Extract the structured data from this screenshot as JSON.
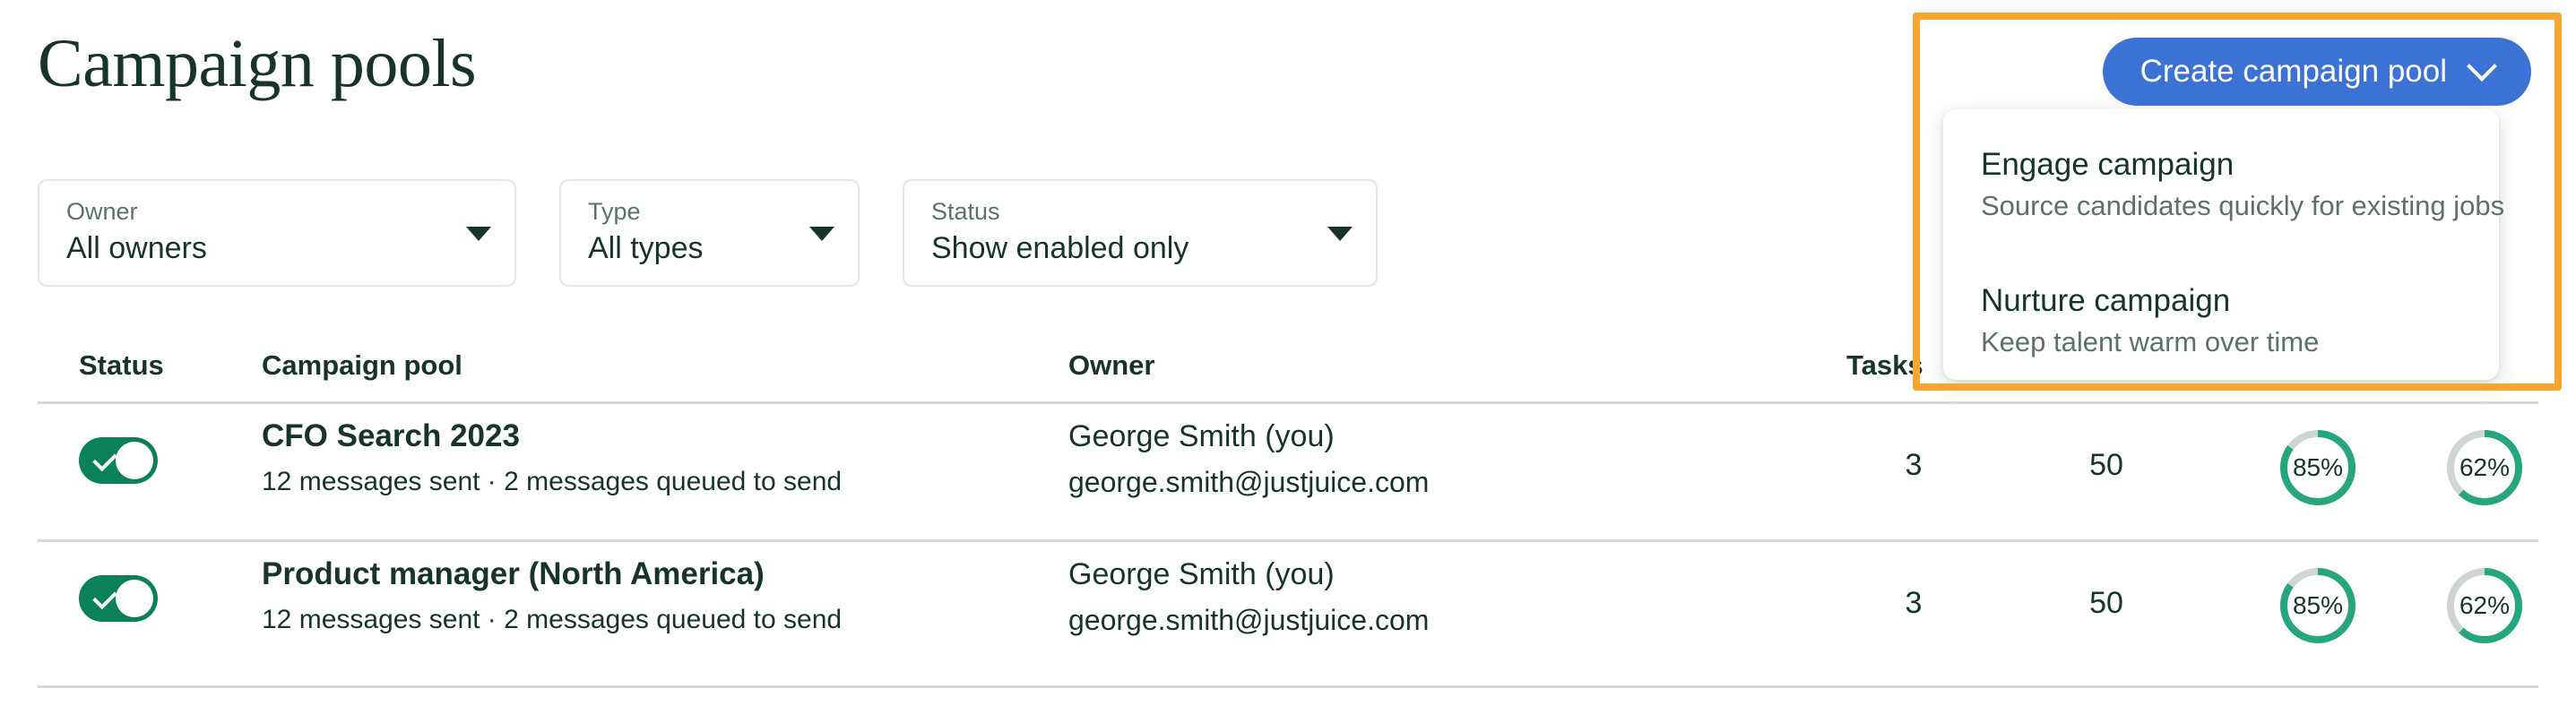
{
  "page": {
    "title": "Campaign pools"
  },
  "colors": {
    "accent_blue": "#3b72d4",
    "brand_green": "#0a8158",
    "ring_green": "#27a57e",
    "ring_track": "#ced5d3",
    "text_dark": "#16342c",
    "text_muted": "#5f706c",
    "annotation_orange": "#f9a533",
    "divider": "#d4dad8"
  },
  "filters": [
    {
      "name": "owner",
      "label": "Owner",
      "value": "All owners",
      "caret": "chevron-down-icon"
    },
    {
      "name": "type",
      "label": "Type",
      "value": "All types",
      "caret": "chevron-down-icon"
    },
    {
      "name": "status",
      "label": "Status",
      "value": "Show enabled only",
      "caret": "chevron-down-icon"
    }
  ],
  "create_button": {
    "label": "Create campaign pool",
    "icon": "chevron-down-icon"
  },
  "create_menu": {
    "expanded": true,
    "items": [
      {
        "title": "Engage campaign",
        "description": "Source candidates quickly for existing jobs"
      },
      {
        "title": "Nurture campaign",
        "description": "Keep talent warm over time"
      }
    ]
  },
  "table": {
    "headers": {
      "status": "Status",
      "pool": "Campaign pool",
      "owner": "Owner",
      "tasks": "Tasks"
    },
    "rows": [
      {
        "enabled": true,
        "toggle_icon": "check-icon",
        "name": "CFO Search 2023",
        "sub": "12 messages sent · 2 messages queued to send",
        "owner_name": "George Smith (you)",
        "owner_email": "george.smith@justjuice.com",
        "tasks": "3",
        "contacts": "50",
        "metric_1": "85%",
        "metric_1_value": 85,
        "metric_2": "62%",
        "metric_2_value": 62
      },
      {
        "enabled": true,
        "toggle_icon": "check-icon",
        "name": "Product manager (North America)",
        "sub": "12 messages sent · 2 messages queued to send",
        "owner_name": "George Smith (you)",
        "owner_email": "george.smith@justjuice.com",
        "tasks": "3",
        "contacts": "50",
        "metric_1": "85%",
        "metric_1_value": 85,
        "metric_2": "62%",
        "metric_2_value": 62
      }
    ]
  }
}
